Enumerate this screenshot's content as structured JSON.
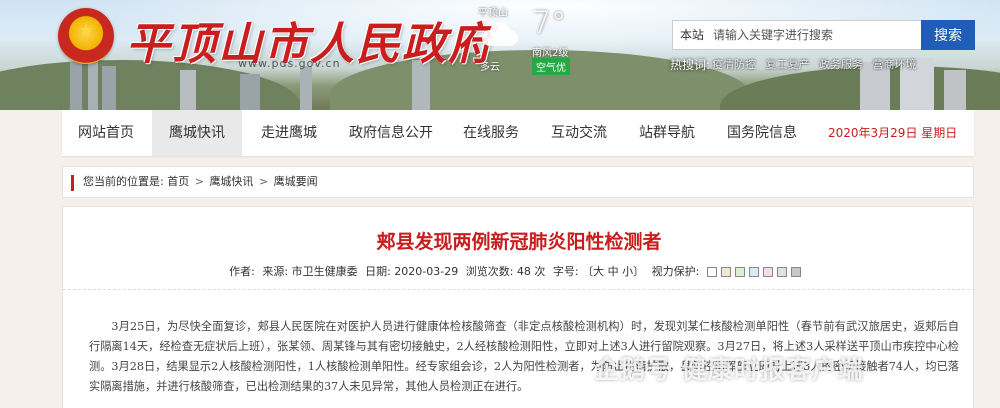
{
  "header": {
    "site_title": "平顶山市人民政府",
    "site_url": "www.pds.gov.cn",
    "weather": {
      "city": "平顶山",
      "temperature": "7°",
      "wind": "南风2级",
      "description": "多云",
      "air_quality": "空气优"
    },
    "search": {
      "scope": "本站",
      "placeholder": "请输入关键字进行搜索",
      "button": "搜索"
    },
    "hotwords_label": "热搜词:",
    "hotwords": "疫情防控 复工复产 政务服务 营商环境"
  },
  "nav": {
    "items": [
      {
        "label": "网站首页",
        "active": false
      },
      {
        "label": "鹰城快讯",
        "active": true
      },
      {
        "label": "走进鹰城",
        "active": false
      },
      {
        "label": "政府信息公开",
        "active": false
      },
      {
        "label": "在线服务",
        "active": false
      },
      {
        "label": "互动交流",
        "active": false
      },
      {
        "label": "站群导航",
        "active": false
      },
      {
        "label": "国务院信息",
        "active": false
      }
    ],
    "date": "2020年3月29日 星期日"
  },
  "breadcrumb": {
    "label": "您当前的位置是:",
    "items": [
      "首页",
      "鹰城快讯",
      "鹰城要闻"
    ],
    "separator": ">"
  },
  "article": {
    "title": "郏县发现两例新冠肺炎阳性检测者",
    "meta": {
      "author": "作者:",
      "source": "来源: 市卫生健康委",
      "date": "日期: 2020-03-29",
      "views": "浏览次数: 48 次",
      "font_size": "字号: 〔大 中 小〕",
      "eye_care": "视力保护:"
    },
    "eye_care_colors": [
      "#ffffff",
      "#f2e6cf",
      "#d9f0d3",
      "#dbe8f6",
      "#f6dbe8",
      "#e2e2e2",
      "#c9c9c9"
    ],
    "body": "3月25日，为尽快全面复诊，郏县人民医院在对医护人员进行健康体检核酸筛查（非定点核酸检测机构）时，发现刘某仁核酸检测单阳性（春节前有武汉旅居史，返郏后自行隔离14天，经检查无症状后上班），张某领、周某锋与其有密切接触史，2人经核酸检测阳性，立即对上述3人进行留院观察。3月27日，将上述3人采样送平顶山市疾控中心检测。3月28日，结果显示2人核酸检测阳性，1人核酸检测单阳性。经专家组会诊，2人为阳性检测者，为防止疫情扩散，县防控指挥部立即对上述3人的密切接触者74人，均已落实隔离措施，并进行核酸筛查，已出检测结果的37人未见异常，其他人员检测正在进行。"
  },
  "watermark": "企鹅号 健康时报客户端"
}
